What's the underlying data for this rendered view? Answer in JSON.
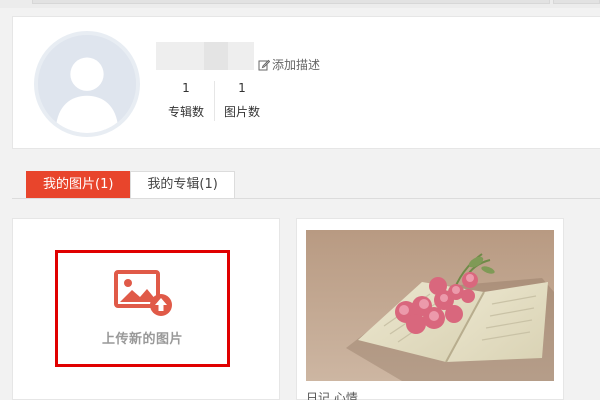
{
  "profile": {
    "add_description": "添加描述",
    "stats": [
      {
        "count": "1",
        "label": "专辑数"
      },
      {
        "count": "1",
        "label": "图片数"
      }
    ]
  },
  "tabs": [
    {
      "label": "我的图片(1)",
      "active": true
    },
    {
      "label": "我的专辑(1)",
      "active": false
    }
  ],
  "upload": {
    "label": "上传新的图片"
  },
  "photos": [
    {
      "caption": "日记 心情"
    }
  ],
  "colors": {
    "accent": "#e8452c",
    "highlight_border": "#e00000",
    "upload_icon": "#e05a48"
  },
  "icons": {
    "add_description": "edit-icon",
    "upload": "image-upload-icon",
    "avatar": "default-user-avatar"
  }
}
